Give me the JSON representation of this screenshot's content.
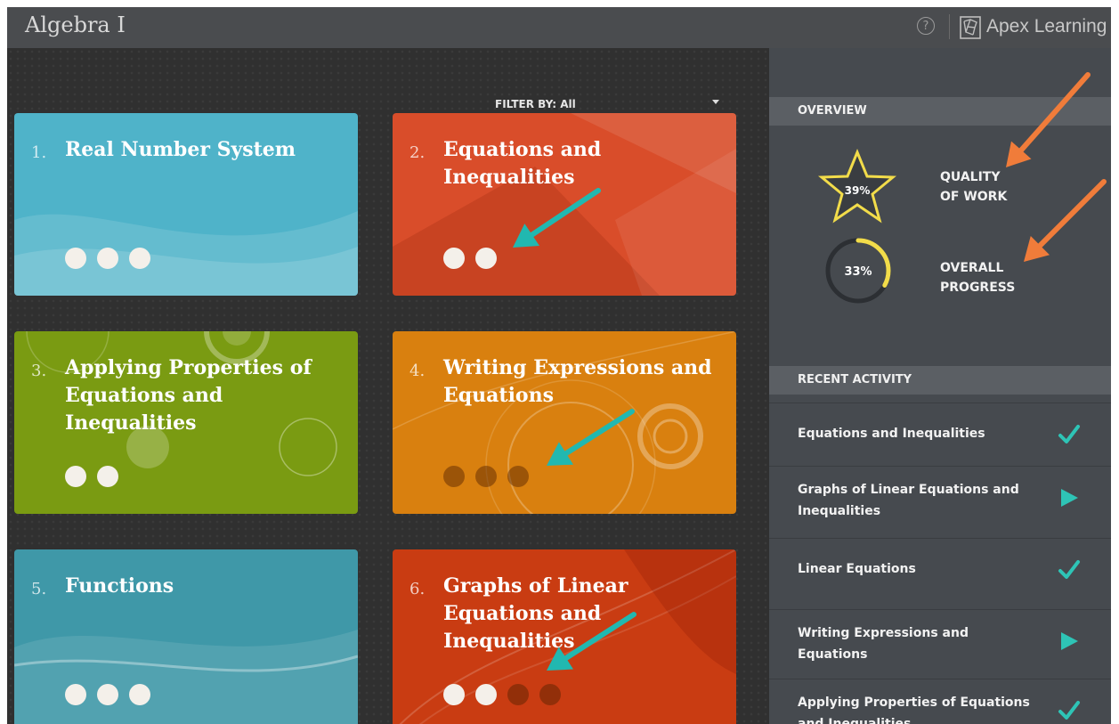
{
  "header": {
    "app_title": "Algebra I",
    "help_symbol": "?",
    "brand": "Apex Learning",
    "help_icon": "question-circle-icon",
    "logo_icon": "apex-logo-icon"
  },
  "filter": {
    "label": "FILTER BY: All",
    "caret_icon": "caret-down-icon"
  },
  "units": [
    {
      "number": "1.",
      "title": "Real Number System",
      "color": "#4fb3c9",
      "dots": [
        "on",
        "on",
        "on"
      ]
    },
    {
      "number": "2.",
      "title": "Equations and Inequalities",
      "color": "#d94d2a",
      "dots": [
        "on",
        "on"
      ]
    },
    {
      "number": "3.",
      "title": "Applying Properties of Equations and Inequalities",
      "color": "#7a9b12",
      "dots": [
        "on",
        "on"
      ]
    },
    {
      "number": "4.",
      "title": "Writing Expressions and Equations",
      "color": "#d9800f",
      "dots": [
        "off",
        "off",
        "off"
      ]
    },
    {
      "number": "5.",
      "title": "Functions",
      "color": "#3f98a8",
      "dots": [
        "on",
        "on",
        "on"
      ]
    },
    {
      "number": "6.",
      "title": "Graphs of Linear Equations and Inequalities",
      "color": "#c93c12",
      "dots": [
        "on",
        "on",
        "off",
        "off"
      ]
    }
  ],
  "overview": {
    "heading": "OVERVIEW",
    "quality": {
      "value": "39%",
      "label_line1": "QUALITY",
      "label_line2": "OF WORK",
      "icon": "star-icon",
      "star_color": "#f2dc4a"
    },
    "progress": {
      "value": "33%",
      "fraction": 0.33,
      "label_line1": "OVERALL",
      "label_line2": "PROGRESS",
      "ring_color": "#f2dc4a"
    }
  },
  "recent_activity": {
    "heading": "RECENT ACTIVITY",
    "items": [
      {
        "label": "Equations and Inequalities",
        "icon": "checkmark-icon"
      },
      {
        "label": "Graphs of Linear Equations and Inequalities",
        "icon": "play-icon"
      },
      {
        "label": "Linear Equations",
        "icon": "checkmark-icon"
      },
      {
        "label": "Writing Expressions and Equations",
        "icon": "play-icon"
      },
      {
        "label": "Applying Properties of Equations and Inequalities",
        "icon": "checkmark-icon"
      }
    ]
  },
  "annotation_colors": {
    "teal_arrow": "#21b8b0",
    "orange_arrow": "#f07c3a"
  }
}
